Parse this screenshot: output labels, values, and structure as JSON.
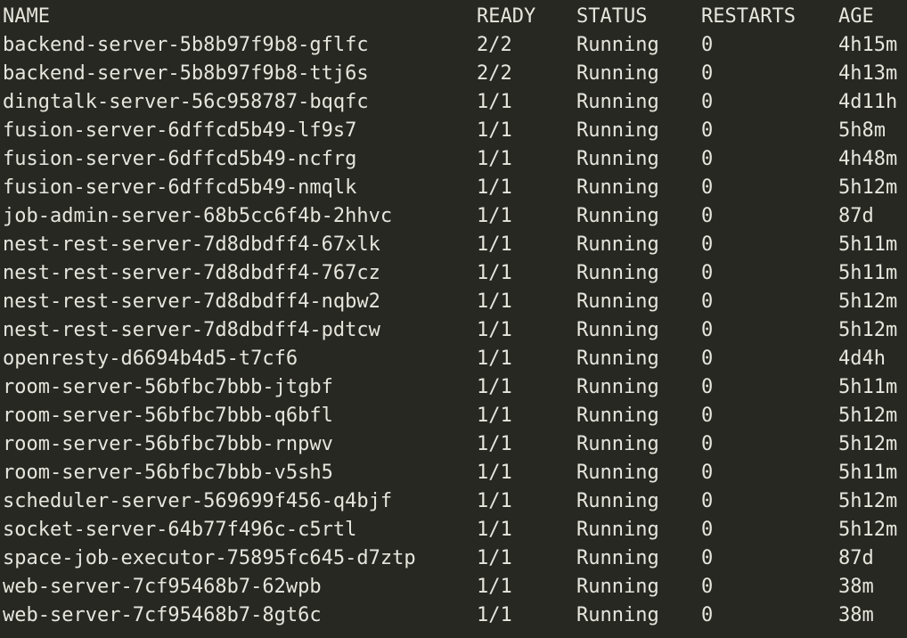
{
  "header": {
    "name": "NAME",
    "ready": "READY",
    "status": "STATUS",
    "restarts": "RESTARTS",
    "age": "AGE"
  },
  "pods": [
    {
      "name": "backend-server-5b8b97f9b8-gflfc",
      "ready": "2/2",
      "status": "Running",
      "restarts": "0",
      "age": "4h15m"
    },
    {
      "name": "backend-server-5b8b97f9b8-ttj6s",
      "ready": "2/2",
      "status": "Running",
      "restarts": "0",
      "age": "4h13m"
    },
    {
      "name": "dingtalk-server-56c958787-bqqfc",
      "ready": "1/1",
      "status": "Running",
      "restarts": "0",
      "age": "4d11h"
    },
    {
      "name": "fusion-server-6dffcd5b49-lf9s7",
      "ready": "1/1",
      "status": "Running",
      "restarts": "0",
      "age": "5h8m"
    },
    {
      "name": "fusion-server-6dffcd5b49-ncfrg",
      "ready": "1/1",
      "status": "Running",
      "restarts": "0",
      "age": "4h48m"
    },
    {
      "name": "fusion-server-6dffcd5b49-nmqlk",
      "ready": "1/1",
      "status": "Running",
      "restarts": "0",
      "age": "5h12m"
    },
    {
      "name": "job-admin-server-68b5cc6f4b-2hhvc",
      "ready": "1/1",
      "status": "Running",
      "restarts": "0",
      "age": "87d"
    },
    {
      "name": "nest-rest-server-7d8dbdff4-67xlk",
      "ready": "1/1",
      "status": "Running",
      "restarts": "0",
      "age": "5h11m"
    },
    {
      "name": "nest-rest-server-7d8dbdff4-767cz",
      "ready": "1/1",
      "status": "Running",
      "restarts": "0",
      "age": "5h11m"
    },
    {
      "name": "nest-rest-server-7d8dbdff4-nqbw2",
      "ready": "1/1",
      "status": "Running",
      "restarts": "0",
      "age": "5h12m"
    },
    {
      "name": "nest-rest-server-7d8dbdff4-pdtcw",
      "ready": "1/1",
      "status": "Running",
      "restarts": "0",
      "age": "5h12m"
    },
    {
      "name": "openresty-d6694b4d5-t7cf6",
      "ready": "1/1",
      "status": "Running",
      "restarts": "0",
      "age": "4d4h"
    },
    {
      "name": "room-server-56bfbc7bbb-jtgbf",
      "ready": "1/1",
      "status": "Running",
      "restarts": "0",
      "age": "5h11m"
    },
    {
      "name": "room-server-56bfbc7bbb-q6bfl",
      "ready": "1/1",
      "status": "Running",
      "restarts": "0",
      "age": "5h12m"
    },
    {
      "name": "room-server-56bfbc7bbb-rnpwv",
      "ready": "1/1",
      "status": "Running",
      "restarts": "0",
      "age": "5h12m"
    },
    {
      "name": "room-server-56bfbc7bbb-v5sh5",
      "ready": "1/1",
      "status": "Running",
      "restarts": "0",
      "age": "5h11m"
    },
    {
      "name": "scheduler-server-569699f456-q4bjf",
      "ready": "1/1",
      "status": "Running",
      "restarts": "0",
      "age": "5h12m"
    },
    {
      "name": "socket-server-64b77f496c-c5rtl",
      "ready": "1/1",
      "status": "Running",
      "restarts": "0",
      "age": "5h12m"
    },
    {
      "name": "space-job-executor-75895fc645-d7ztp",
      "ready": "1/1",
      "status": "Running",
      "restarts": "0",
      "age": "87d"
    },
    {
      "name": "web-server-7cf95468b7-62wpb",
      "ready": "1/1",
      "status": "Running",
      "restarts": "0",
      "age": "38m"
    },
    {
      "name": "web-server-7cf95468b7-8gt6c",
      "ready": "1/1",
      "status": "Running",
      "restarts": "0",
      "age": "38m"
    }
  ],
  "colors": {
    "background": "#272822",
    "foreground": "#e6e6dd"
  }
}
